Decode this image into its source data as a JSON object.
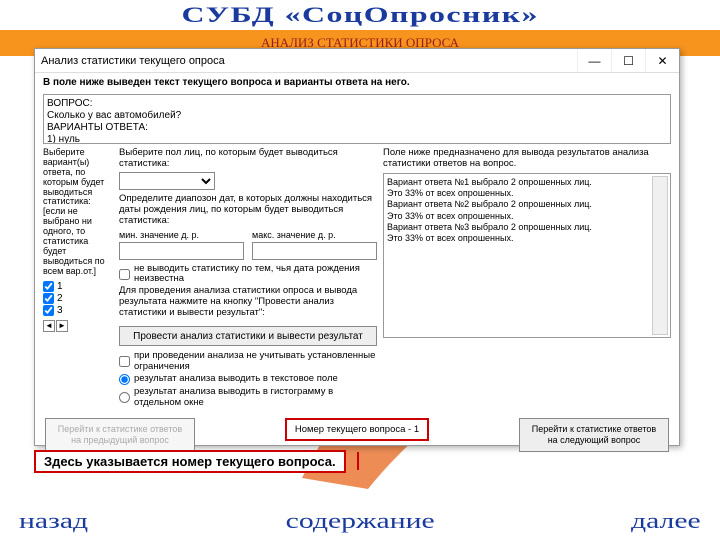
{
  "header": {
    "app_title": "СУБД «СоцОпросник»",
    "subtitle": "АНАЛИЗ СТАТИСТИКИ ОПРОСА"
  },
  "dialog": {
    "title": "Анализ статистики текущего опроса",
    "instruction": "В поле ниже выведен текст текущего вопроса и варианты ответа на него.",
    "question_block": "ВОПРОС:\nСколько у вас автомобилей?\nВАРИАНТЫ ОТВЕТА:\n1) нуль",
    "left": {
      "label": "Выберите вариант(ы) ответа, по которым будет выводиться статистика: [если не выбрано ни одного, то статистика будет выводиться по всем вар.от.]",
      "options": [
        "1",
        "2",
        "3"
      ],
      "checked": [
        true,
        true,
        true
      ]
    },
    "mid": {
      "gender_label": "Выберите пол лиц, по которым будет выводиться статистика:",
      "gender_value": "",
      "date_label": "Определите диапозон дат, в которых должны находиться даты рождения лиц, по которым будет выводиться статистика:",
      "min_date_caption": "мин. значение д. р.",
      "max_date_caption": "макс. значение д. р.",
      "min_date": "",
      "max_date": "",
      "chk_nodob": "не выводить статистику по тем, чья дата рождения неизвестна",
      "run_hint": "Для проведения анализа статистики опроса и вывода результата нажмите на кнопку \"Провести анализ статистики и вывести результат\":",
      "run_button": "Провести анализ статистики и вывести результат",
      "chk_norestrict": "при проведении анализа не учитывать установленные ограничения",
      "radio_text": "результат анализа выводить в текстовое поле",
      "radio_histo": "результат анализа выводить в гистограмму в отдельном окне"
    },
    "right": {
      "caption": "Поле ниже предназначено для вывода результатов анализа статистики ответов на вопрос.",
      "results": [
        "Вариант ответа №1 выбрало 2 опрошенных лиц.",
        "Это 33% от всех опрошенных.",
        "Вариант ответа №2 выбрало 2 опрошенных лиц.",
        "Это 33% от всех опрошенных.",
        "Вариант ответа №3 выбрало 2 опрошенных лиц.",
        "Это 33% от всех опрошенных."
      ]
    },
    "bottom": {
      "prev": "Перейти к статистике ответов на предыдущий вопрос",
      "current": "Номер текущего вопроса - 1",
      "next": "Перейти к статистике ответов на следующий вопрос"
    }
  },
  "annotation": "Здесь указывается номер текущего вопроса.",
  "footer": {
    "back": "назад",
    "contents": "содержание",
    "next": "далее"
  }
}
